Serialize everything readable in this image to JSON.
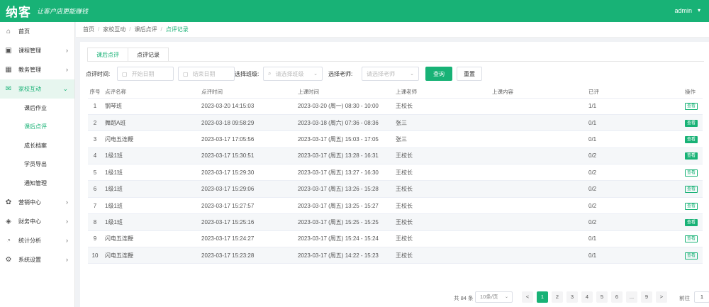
{
  "header": {
    "logo": "纳客",
    "slogan": "让客户店更能赚钱",
    "user": "admin"
  },
  "sidebar": {
    "items": [
      {
        "label": "首页",
        "icon": "home-icon",
        "chevron": false
      },
      {
        "label": "课程管理",
        "icon": "book-icon",
        "chevron": true
      },
      {
        "label": "教务管理",
        "icon": "calendar-icon",
        "chevron": true
      },
      {
        "label": "家校互动",
        "icon": "message-icon",
        "chevron": true,
        "open": true
      }
    ],
    "subitems": [
      {
        "label": "课后作业"
      },
      {
        "label": "课后点评",
        "active": true
      },
      {
        "label": "成长档案"
      },
      {
        "label": "学员导出"
      },
      {
        "label": "通知管理"
      }
    ],
    "items_after": [
      {
        "label": "营销中心",
        "icon": "gift-icon"
      },
      {
        "label": "财务中心",
        "icon": "wallet-icon"
      },
      {
        "label": "统计分析",
        "icon": "chart-icon"
      },
      {
        "label": "系统设置",
        "icon": "gear-icon"
      }
    ]
  },
  "breadcrumb": [
    "首页",
    "家校互动",
    "课后点评",
    "点评记录"
  ],
  "tabs": [
    {
      "label": "课后点评",
      "active": true
    },
    {
      "label": "点评记录",
      "active": false
    }
  ],
  "filters": {
    "time_label": "点评时间:",
    "start_placeholder": "开始日期",
    "end_placeholder": "结束日期",
    "class_label": "选择班级:",
    "class_placeholder": "请选择班级",
    "teacher_label": "选择老师:",
    "teacher_placeholder": "请选择老师",
    "query_button": "查询",
    "reset_button": "重置"
  },
  "table": {
    "columns": [
      "序号",
      "点评名称",
      "点评时间",
      "上课时间",
      "上课老师",
      "上课内容",
      "已评",
      "操作"
    ],
    "rows": [
      {
        "idx": "1",
        "name": "钢琴班",
        "review_time": "2023-03-20 14:15:03",
        "class_time": "2023-03-20 (周一) 08:30 - 10:00",
        "teacher": "王校长",
        "content": "",
        "done": "1/1",
        "op": "查看",
        "solid": false
      },
      {
        "idx": "2",
        "name": "舞蹈A班",
        "review_time": "2023-03-18 09:58:29",
        "class_time": "2023-03-18 (周六) 07:36 - 08:36",
        "teacher": "张三",
        "content": "",
        "done": "0/1",
        "op": "查看",
        "solid": true
      },
      {
        "idx": "3",
        "name": "闪电五连鞭",
        "review_time": "2023-03-17 17:05:56",
        "class_time": "2023-03-17 (周五) 15:03 - 17:05",
        "teacher": "张三",
        "content": "",
        "done": "0/1",
        "op": "查看",
        "solid": true
      },
      {
        "idx": "4",
        "name": "1级1班",
        "review_time": "2023-03-17 15:30:51",
        "class_time": "2023-03-17 (周五) 13:28 - 16:31",
        "teacher": "王校长",
        "content": "",
        "done": "0/2",
        "op": "查看",
        "solid": true
      },
      {
        "idx": "5",
        "name": "1级1班",
        "review_time": "2023-03-17 15:29:30",
        "class_time": "2023-03-17 (周五) 13:27 - 16:30",
        "teacher": "王校长",
        "content": "",
        "done": "0/2",
        "op": "查看",
        "solid": false
      },
      {
        "idx": "6",
        "name": "1级1班",
        "review_time": "2023-03-17 15:29:06",
        "class_time": "2023-03-17 (周五) 13:26 - 15:28",
        "teacher": "王校长",
        "content": "",
        "done": "0/2",
        "op": "查看",
        "solid": false
      },
      {
        "idx": "7",
        "name": "1级1班",
        "review_time": "2023-03-17 15:27:57",
        "class_time": "2023-03-17 (周五) 13:25 - 15:27",
        "teacher": "王校长",
        "content": "",
        "done": "0/2",
        "op": "查看",
        "solid": false
      },
      {
        "idx": "8",
        "name": "1级1班",
        "review_time": "2023-03-17 15:25:16",
        "class_time": "2023-03-17 (周五) 15:25 - 15:25",
        "teacher": "王校长",
        "content": "",
        "done": "0/2",
        "op": "查看",
        "solid": true
      },
      {
        "idx": "9",
        "name": "闪电五连鞭",
        "review_time": "2023-03-17 15:24:27",
        "class_time": "2023-03-17 (周五) 15:24 - 15:24",
        "teacher": "王校长",
        "content": "",
        "done": "0/1",
        "op": "查看",
        "solid": false
      },
      {
        "idx": "10",
        "name": "闪电五连鞭",
        "review_time": "2023-03-17 15:23:28",
        "class_time": "2023-03-17 (周五) 14:22 - 15:23",
        "teacher": "王校长",
        "content": "",
        "done": "0/1",
        "op": "查看",
        "solid": false
      }
    ]
  },
  "pagination": {
    "total": "共 84 条",
    "page_size": "10条/页",
    "pages": [
      "1",
      "2",
      "3",
      "4",
      "5",
      "6",
      "...",
      "9"
    ],
    "prev": "<",
    "next": ">",
    "goto_label": "前往",
    "goto_value": "1",
    "current": "1"
  },
  "colors": {
    "accent": "#18b276"
  }
}
